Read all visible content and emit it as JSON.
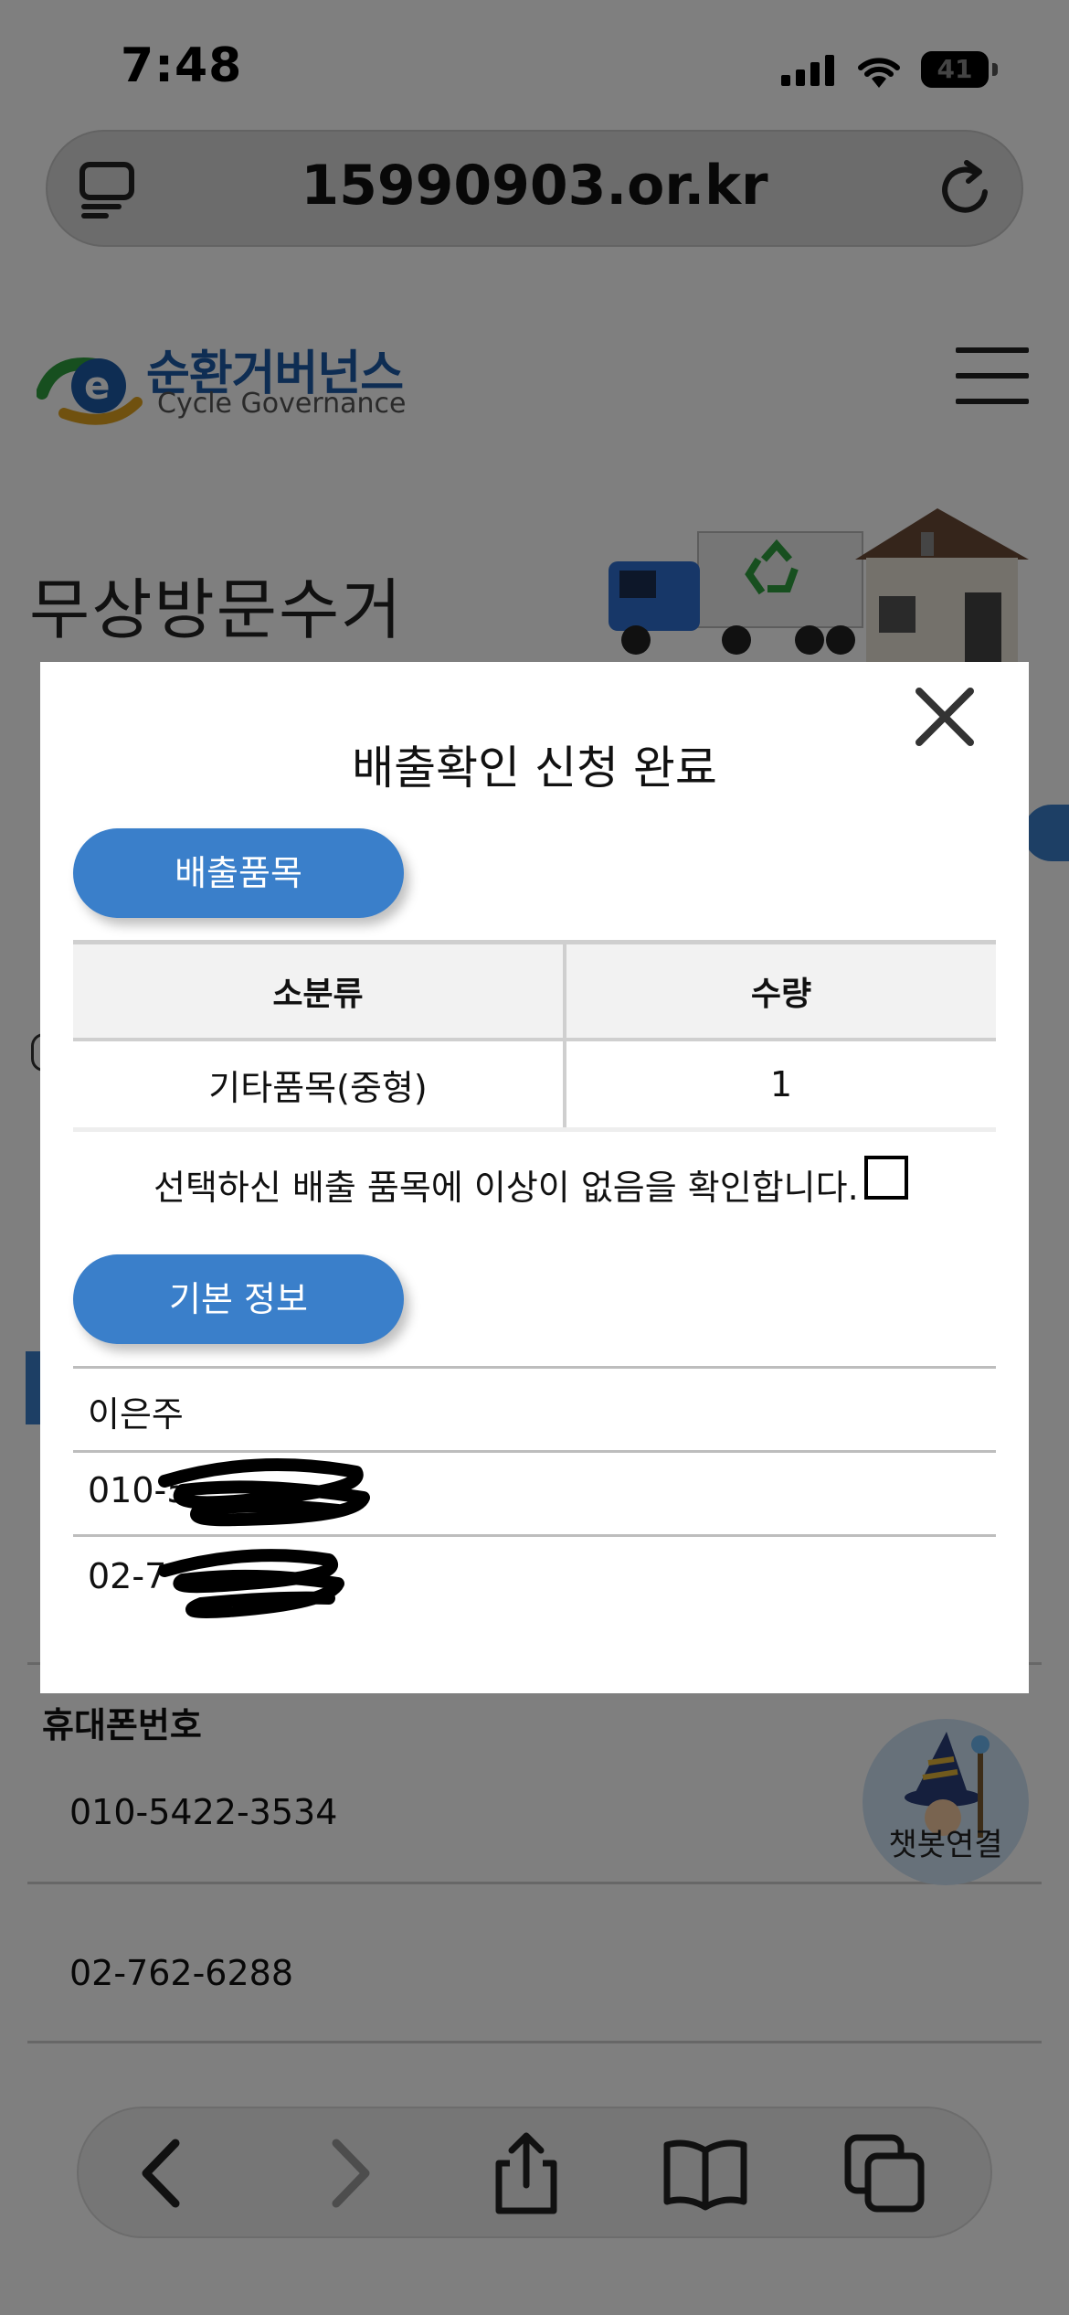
{
  "status_bar": {
    "time": "7:48",
    "battery": "41"
  },
  "browser": {
    "url": "15990903.or.kr"
  },
  "site": {
    "logo_ko": "순환거버넌스",
    "logo_en": "Cycle Governance",
    "page_title": "무상방문수거"
  },
  "background": {
    "phone_label": "휴대폰번호",
    "phone_value": "010-5422-3534",
    "tel_value": "02-762-6288"
  },
  "chatbot": {
    "label": "챗봇연결"
  },
  "modal": {
    "title": "배출확인 신청 완료",
    "items_button": "배출품목",
    "table": {
      "headers": [
        "소분류",
        "수량"
      ],
      "rows": [
        {
          "category": "기타품목(중형)",
          "quantity": "1"
        }
      ]
    },
    "confirm_text": "선택하신 배출 품목에 이상이 없음을 확인합니다.",
    "info_button": "기본 정보",
    "info": {
      "name": "이은주",
      "phone_visible": "010-5",
      "tel_visible": "02-7"
    }
  },
  "colors": {
    "accent": "#3a7fca",
    "overlay": "rgba(0,0,0,0.5)"
  }
}
